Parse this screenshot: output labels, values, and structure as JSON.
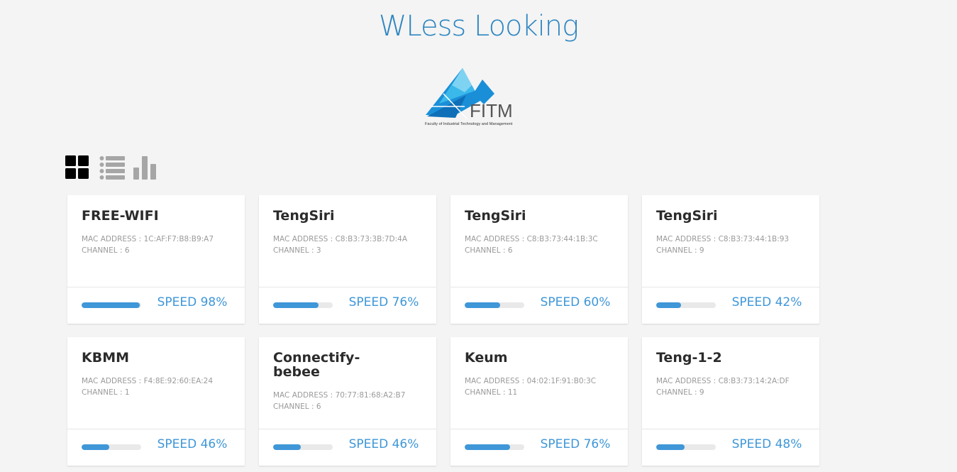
{
  "app": {
    "title": "WLess Looking"
  },
  "logo": {
    "brand": "FITM",
    "subtitle": "Faculty of Industrial Technology and Management"
  },
  "views": [
    {
      "name": "grid-view-icon",
      "active": true
    },
    {
      "name": "list-view-icon",
      "active": false
    },
    {
      "name": "chart-view-icon",
      "active": false
    }
  ],
  "labels": {
    "mac_prefix": "MAC ADDRESS : ",
    "channel_prefix": "CHANNEL : ",
    "speed_prefix": "SPEED "
  },
  "colors": {
    "accent": "#3f97d8",
    "title": "#2e86c1"
  },
  "networks": [
    {
      "ssid": "FREE-WIFI",
      "mac": "1C:AF:F7:B8:B9:A7",
      "channel": "6",
      "speed": 98
    },
    {
      "ssid": "TengSiri",
      "mac": "C8:B3:73:3B:7D:4A",
      "channel": "3",
      "speed": 76
    },
    {
      "ssid": "TengSiri",
      "mac": "C8:B3:73:44:1B:3C",
      "channel": "6",
      "speed": 60
    },
    {
      "ssid": "TengSiri",
      "mac": "C8:B3:73:44:1B:93",
      "channel": "9",
      "speed": 42
    },
    {
      "ssid": "KBMM",
      "mac": "F4:8E:92:60:EA:24",
      "channel": "1",
      "speed": 46
    },
    {
      "ssid": "Connectify-bebee",
      "mac": "70:77:81:68:A2:B7",
      "channel": "6",
      "speed": 46
    },
    {
      "ssid": "Keum",
      "mac": "04:02:1F:91:B0:3C",
      "channel": "11",
      "speed": 76
    },
    {
      "ssid": "Teng-1-2",
      "mac": "C8:B3:73:14:2A:DF",
      "channel": "9",
      "speed": 48
    }
  ]
}
